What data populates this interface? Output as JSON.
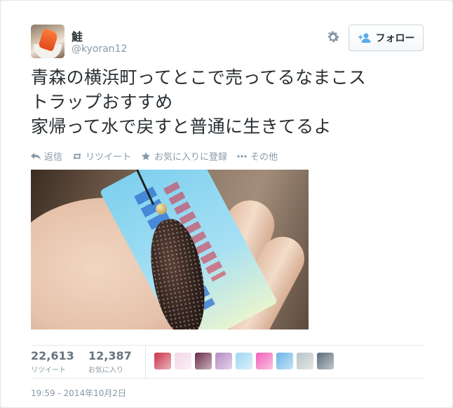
{
  "user": {
    "display_name": "鮭",
    "screen_name": "@kyoran12"
  },
  "header": {
    "follow_label": "フォロー"
  },
  "tweet": {
    "lines": [
      "青森の横浜町ってとこで売ってるなまこス",
      "トラップおすすめ",
      "家帰って水で戻すと普通に生きてるよ"
    ]
  },
  "actions": {
    "reply": "返信",
    "retweet": "リツイート",
    "favorite": "お気に入りに登録",
    "more": "その他"
  },
  "stats": {
    "retweets": {
      "count": "22,613",
      "label": "リツイート"
    },
    "favorites": {
      "count": "12,387",
      "label": "お気に入り"
    }
  },
  "timestamp": "19:59 - 2014年10月2日",
  "colors": {
    "text": "#292f33",
    "muted": "#8899a6",
    "border": "#e1e8ed",
    "follow_icon": "#55acee"
  },
  "avatars": [
    "#c8334a",
    "#f3d6e4",
    "#6b2b4a",
    "#b48ac2",
    "#9fd6f0",
    "#f25fb8",
    "#6ab4e8",
    "#b7c2c4",
    "#5a6b7a"
  ]
}
